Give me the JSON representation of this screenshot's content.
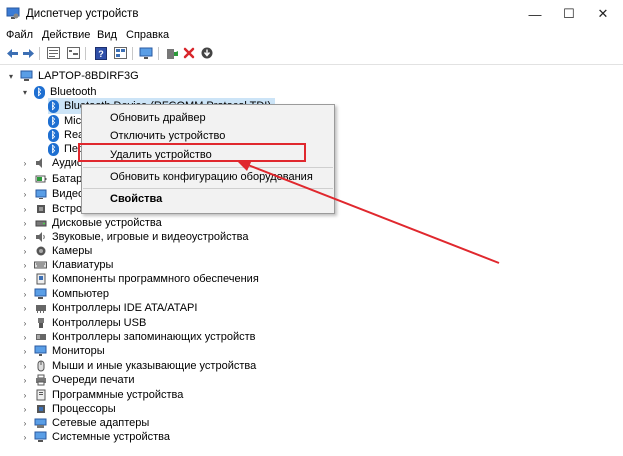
{
  "window": {
    "title": "Диспетчер устройств"
  },
  "window_controls": {
    "minimize": "—",
    "maximize": "☐",
    "close": "✕"
  },
  "menu": [
    "Файл",
    "Действие",
    "Вид",
    "Справка"
  ],
  "toolbar_icons": [
    "back-arrow-icon",
    "forward-arrow-icon",
    "properties-icon",
    "tree-view-icon",
    "help-icon",
    "view-details-icon",
    "monitor-icon",
    "add-driver-icon",
    "remove-device-icon",
    "download-driver-icon"
  ],
  "tree": {
    "root": "LAPTOP-8BDIRF3G",
    "bluetooth": {
      "label": "Bluetooth",
      "children": [
        "Bluetooth Device (RFCOMM Protocol TDI)",
        "Mic",
        "Rea",
        "Пер"
      ]
    },
    "categories": [
      "Аудио",
      "Батаре",
      "Видео",
      "Встрое",
      "Дисковые устройства",
      "Звуковые, игровые и видеоустройства",
      "Камеры",
      "Клавиатуры",
      "Компоненты программного обеспечения",
      "Компьютер",
      "Контроллеры IDE ATA/ATAPI",
      "Контроллеры USB",
      "Контроллеры запоминающих устройств",
      "Мониторы",
      "Мыши и иные указывающие устройства",
      "Очереди печати",
      "Программные устройства",
      "Процессоры",
      "Сетевые адаптеры",
      "Системные устройства"
    ]
  },
  "context_menu": {
    "update_driver": "Обновить драйвер",
    "disable_device": "Отключить устройство",
    "uninstall_device": "Удалить устройство",
    "scan_hardware": "Обновить конфигурацию оборудования",
    "properties": "Свойства"
  },
  "colors": {
    "annotation": "#e0282e",
    "bluetooth": "#1e6fd1",
    "selection": "#cce4f7"
  }
}
